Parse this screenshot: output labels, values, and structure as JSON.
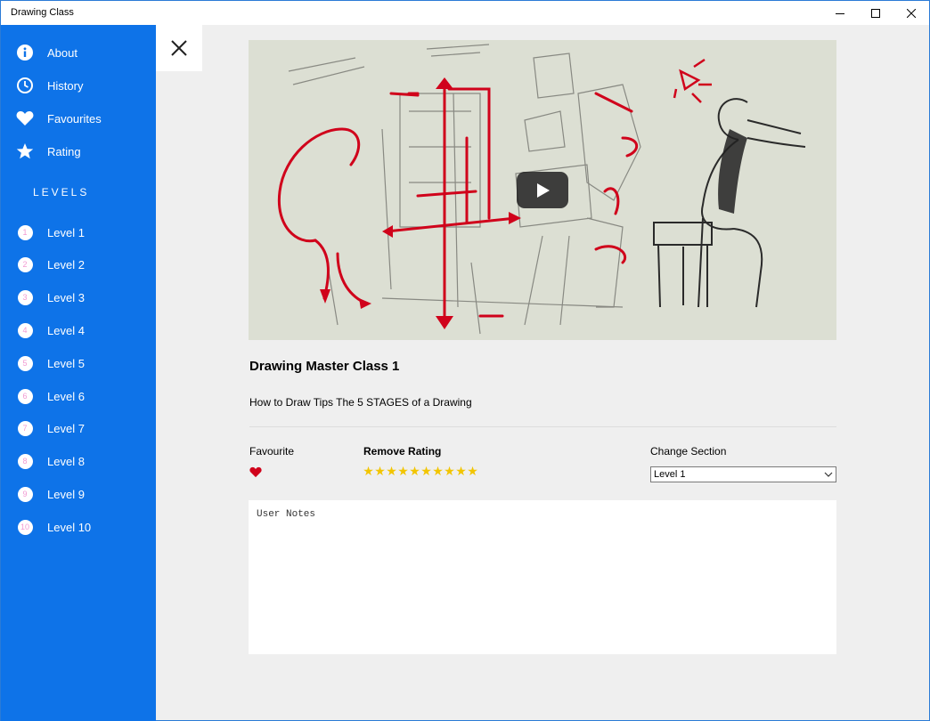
{
  "window": {
    "title": "Drawing Class"
  },
  "sidebar": {
    "items": [
      {
        "label": "About",
        "icon": "info-icon"
      },
      {
        "label": "History",
        "icon": "clock-icon"
      },
      {
        "label": "Favourites",
        "icon": "heart-icon"
      },
      {
        "label": "Rating",
        "icon": "star-icon"
      }
    ],
    "levels_heading": "LEVELS",
    "levels": [
      {
        "num": "1",
        "label": "Level 1"
      },
      {
        "num": "2",
        "label": "Level 2"
      },
      {
        "num": "3",
        "label": "Level 3"
      },
      {
        "num": "4",
        "label": "Level 4"
      },
      {
        "num": "5",
        "label": "Level 5"
      },
      {
        "num": "6",
        "label": "Level 6"
      },
      {
        "num": "7",
        "label": "Level 7"
      },
      {
        "num": "8",
        "label": "Level 8"
      },
      {
        "num": "9",
        "label": "Level 9"
      },
      {
        "num": "10",
        "label": "Level 10"
      }
    ],
    "colors": {
      "background": "#0e73e8",
      "number_text": "#f29ad2"
    }
  },
  "main": {
    "class_title": "Drawing Master Class 1",
    "description": "How to Draw Tips The 5 STAGES of a Drawing",
    "favourite_label": "Favourite",
    "favourite_active": true,
    "rating_label": "Remove Rating",
    "rating_stars": 10,
    "section_label": "Change Section",
    "section_value": "Level 1",
    "notes_placeholder": "User Notes"
  },
  "colors": {
    "accent": "#0e73e8",
    "heart": "#d0021b",
    "star": "#f2c500"
  }
}
